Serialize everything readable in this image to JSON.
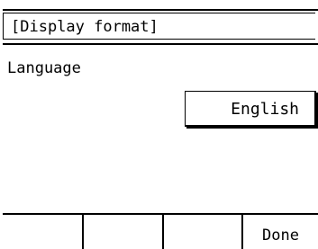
{
  "header": {
    "title": "[Display format]"
  },
  "setting": {
    "label": "Language",
    "value": "English"
  },
  "softkeys": [
    "",
    "",
    "",
    "Done"
  ]
}
